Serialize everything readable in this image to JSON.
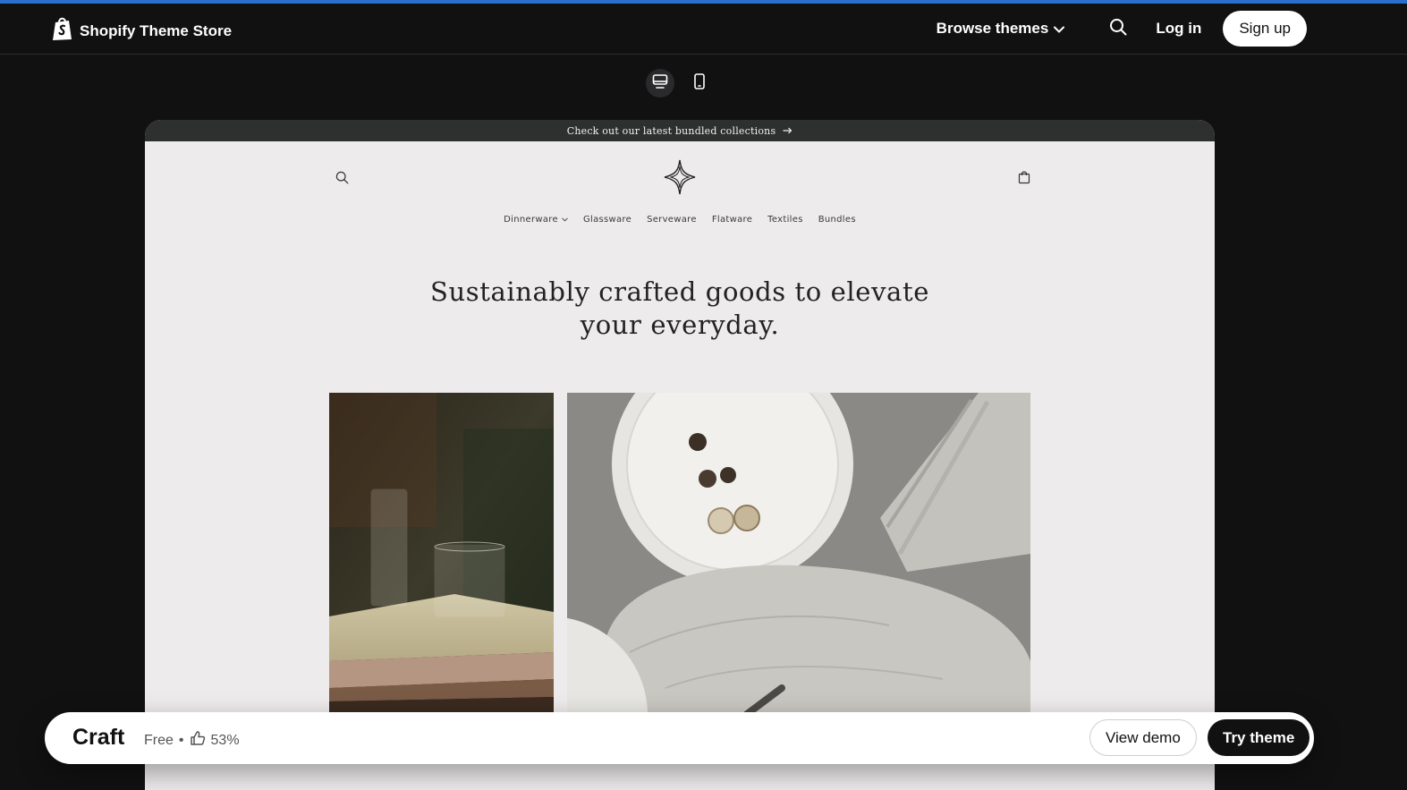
{
  "topbar": {
    "brand": "Shopify Theme Store",
    "browse_label": "Browse themes",
    "login_label": "Log in",
    "signup_label": "Sign up"
  },
  "device_toggle": {
    "selected": "desktop",
    "options": [
      "desktop",
      "mobile"
    ]
  },
  "preview": {
    "announcement": "Check out our latest bundled collections",
    "nav": [
      "Dinnerware",
      "Glassware",
      "Serveware",
      "Flatware",
      "Textiles",
      "Bundles"
    ],
    "hero_line1": "Sustainably crafted goods to elevate",
    "hero_line2": "your everyday."
  },
  "bottom_bar": {
    "theme_name": "Craft",
    "price": "Free",
    "separator": "•",
    "rating": "53%",
    "view_demo_label": "View demo",
    "try_theme_label": "Try theme"
  },
  "colors": {
    "page_bg": "#111112",
    "accent": "#2c6ecb",
    "announcement_bg": "#2d302e",
    "store_bg": "#edebeb"
  },
  "icons": [
    "shopify-bag-icon",
    "chevron-down-icon",
    "search-icon",
    "desktop-icon",
    "mobile-icon",
    "arrow-right-icon",
    "sparkle-logo-icon",
    "cart-icon",
    "thumbs-up-icon"
  ]
}
